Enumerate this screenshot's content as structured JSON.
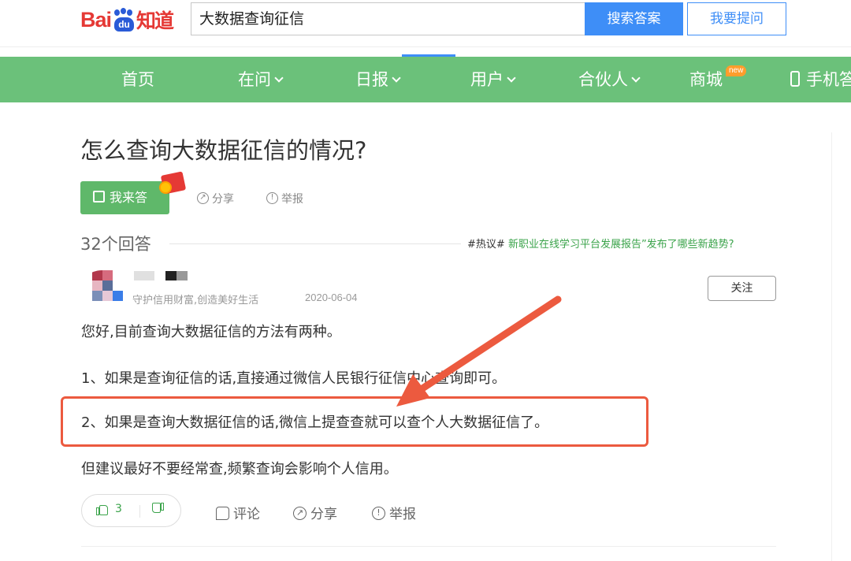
{
  "header": {
    "logo_bai": "Bai",
    "logo_du": "du",
    "logo_zhidao": "知道",
    "search_value": "大数据查询征信",
    "search_button": "搜索答案",
    "ask_button": "我要提问"
  },
  "nav": {
    "items": [
      {
        "label": "首页"
      },
      {
        "label": "在问"
      },
      {
        "label": "日报"
      },
      {
        "label": "用户"
      },
      {
        "label": "合伙人"
      },
      {
        "label": "商城"
      },
      {
        "label": "手机答"
      }
    ],
    "new_badge": "new"
  },
  "question": {
    "title": "怎么查询大数据征信的情况?",
    "answer_button": "我来答",
    "share": "分享",
    "report": "举报"
  },
  "answers": {
    "count_label": "32个回答",
    "hot_tag": "#热议#",
    "hot_link": "新职业在线学习平台发展报告”发布了哪些新趋势?"
  },
  "answer": {
    "author_desc": "守护信用财富,创造美好生活",
    "date": "2020-06-04",
    "follow": "关注",
    "paragraphs": [
      "您好,目前查询大数据征信的方法有两种。",
      "1、如果是查询征信的话,直接通过微信人民银行征信中心查询即可。",
      "2、如果是查询大数据征信的话,微信上提查查就可以查个人大数据征信了。",
      "但建议最好不要经常查,频繁查询会影响个人信用。"
    ],
    "likes": "3",
    "comment": "评论",
    "share": "分享",
    "report": "举报"
  },
  "colors": {
    "nav_green": "#6bc17a",
    "button_blue": "#3e8ef7",
    "logo_red": "#e53935",
    "annotation_red": "#ec5a3f"
  }
}
